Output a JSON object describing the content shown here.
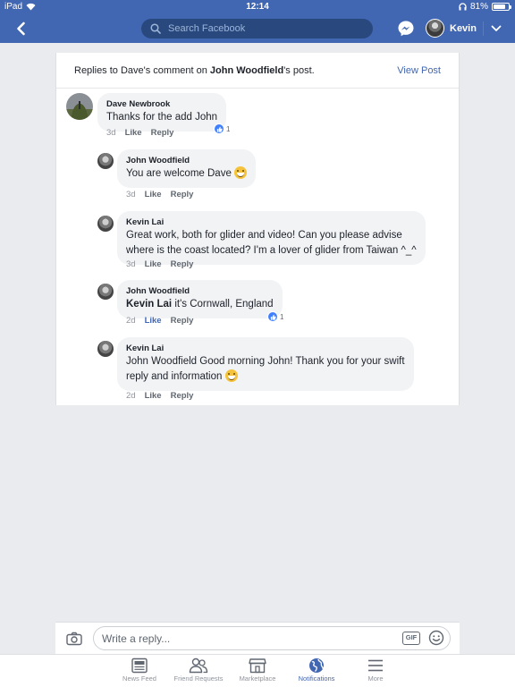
{
  "status_bar": {
    "device": "iPad",
    "time": "12:14",
    "battery": "81%",
    "battery_level": 0.81
  },
  "nav": {
    "search_placeholder": "Search Facebook",
    "user_name": "Kevin"
  },
  "thread": {
    "intro_prefix": "Replies to Dave's comment on ",
    "intro_name": "John Woodfield",
    "intro_suffix": "'s post.",
    "view_post": "View Post"
  },
  "comments": [
    {
      "author": "Dave Newbrook",
      "text": "Thanks for the add John",
      "time": "3d",
      "like": "Like",
      "reply": "Reply",
      "reactions": "1"
    },
    {
      "author": "John Woodfield",
      "text": "You are welcome Dave",
      "emoji": "grinning-face",
      "time": "3d",
      "like": "Like",
      "reply": "Reply"
    },
    {
      "author": "Kevin Lai",
      "text_line1": "Great work, both for glider and video! Can you please advise",
      "text_line2": "where is the coast located? I'm a lover of glider from Taiwan ^_^",
      "time": "3d",
      "like": "Like",
      "reply": "Reply"
    },
    {
      "author": "John Woodfield",
      "mention": "Kevin Lai",
      "text": " it's Cornwall, England",
      "time": "2d",
      "like": "Like",
      "like_state": "liked",
      "reply": "Reply",
      "reactions": "1"
    },
    {
      "author": "Kevin Lai",
      "text_line1": "John Woodfield Good morning John! Thank you for your swift",
      "text_line2": "reply and information",
      "emoji": "grinning-face",
      "time": "2d",
      "like": "Like",
      "reply": "Reply"
    }
  ],
  "composer": {
    "placeholder": "Write a reply...",
    "gif_label": "GIF"
  },
  "tabs": [
    {
      "label": "News Feed",
      "icon": "news-feed-icon"
    },
    {
      "label": "Friend Requests",
      "icon": "friend-requests-icon"
    },
    {
      "label": "Marketplace",
      "icon": "marketplace-icon"
    },
    {
      "label": "Notifications",
      "icon": "globe-icon",
      "active": true
    },
    {
      "label": "More",
      "icon": "menu-icon"
    }
  ],
  "colors": {
    "brand": "#4267b2",
    "background": "#e9ebee",
    "bubble": "#f2f3f5",
    "like_reaction": "#4080ff"
  }
}
